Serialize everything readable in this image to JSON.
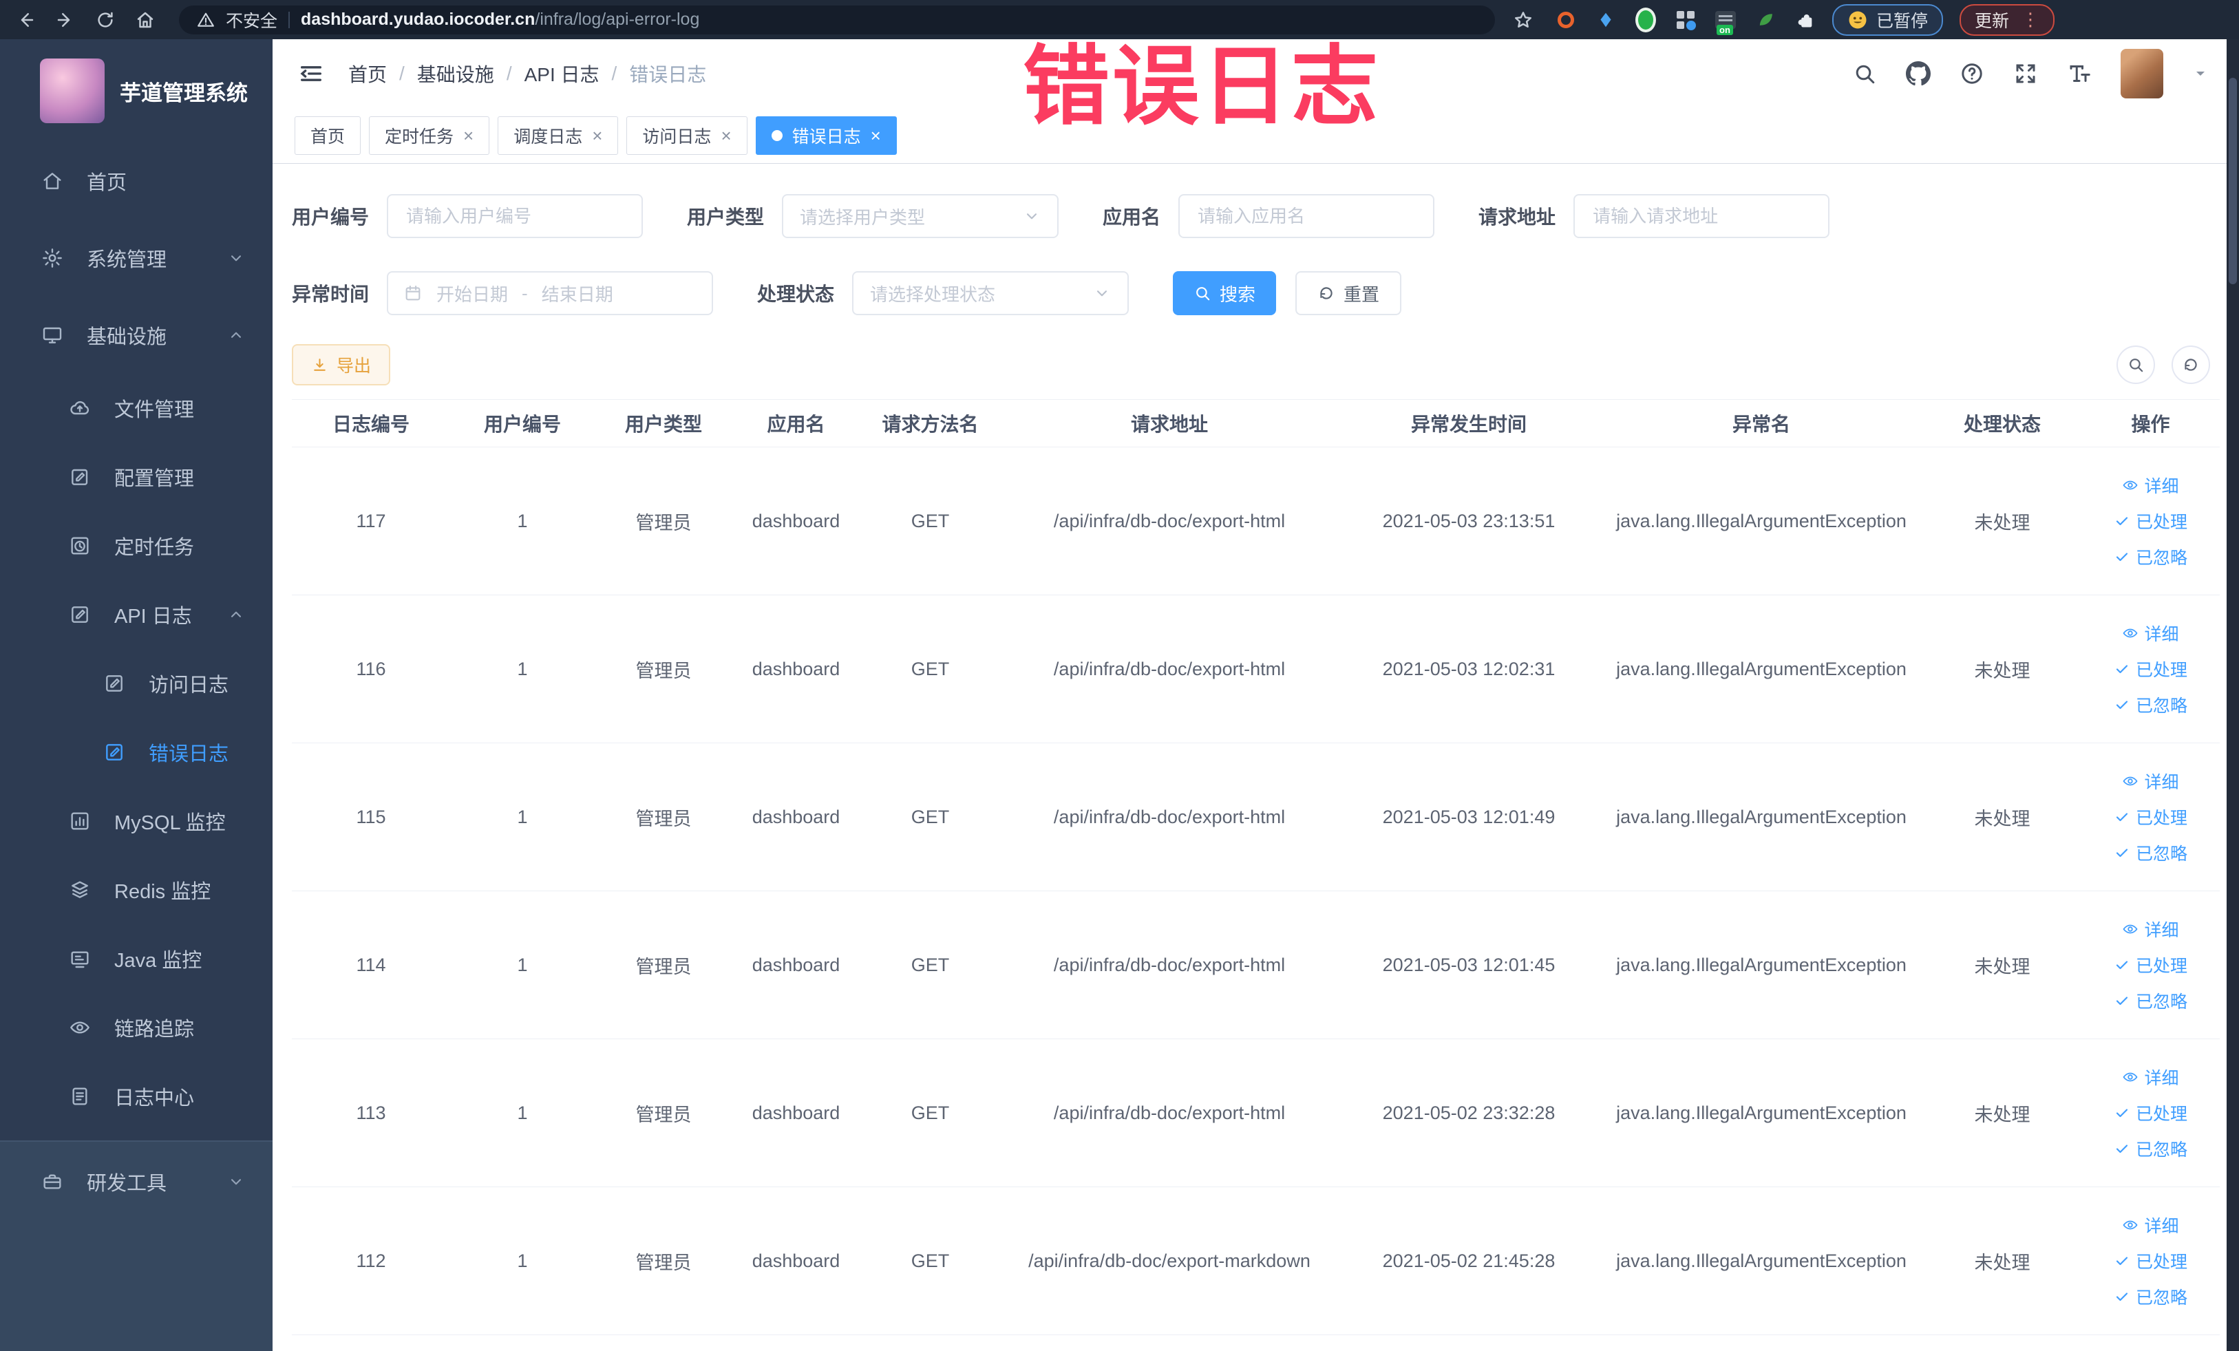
{
  "glyphs": {
    "close": "×",
    "breadcrumb_sep": "/",
    "kebab": "⋮",
    "range_sep": "-"
  },
  "colors": {
    "accent_blue": "#409eff",
    "watermark_red": "#fb3c60",
    "export_orange": "#e6a23c",
    "sidebar_bg": "#2d3b52"
  },
  "browser": {
    "security": "不安全",
    "domain": "dashboard.yudao.iocoder.cn",
    "path": "/infra/log/api-error-log",
    "ext_on_badge": "on",
    "paused": "已暂停",
    "update": "更新"
  },
  "watermark": {
    "text": "错误日志"
  },
  "sidebar": {
    "title": "芋道管理系统",
    "items": [
      {
        "label": "首页"
      },
      {
        "label": "系统管理"
      },
      {
        "label": "基础设施"
      },
      {
        "label": "文件管理"
      },
      {
        "label": "配置管理"
      },
      {
        "label": "定时任务"
      },
      {
        "label": "API 日志"
      },
      {
        "label": "访问日志"
      },
      {
        "label": "错误日志"
      },
      {
        "label": "MySQL 监控"
      },
      {
        "label": "Redis 监控"
      },
      {
        "label": "Java 监控"
      },
      {
        "label": "链路追踪"
      },
      {
        "label": "日志中心"
      },
      {
        "label": "研发工具"
      }
    ]
  },
  "breadcrumb": [
    "首页",
    "基础设施",
    "API 日志",
    "错误日志"
  ],
  "tabs": [
    {
      "label": "首页"
    },
    {
      "label": "定时任务"
    },
    {
      "label": "调度日志"
    },
    {
      "label": "访问日志"
    },
    {
      "label": "错误日志"
    }
  ],
  "filters": {
    "user_id": {
      "label": "用户编号",
      "placeholder": "请输入用户编号"
    },
    "user_type": {
      "label": "用户类型",
      "placeholder": "请选择用户类型"
    },
    "app_name": {
      "label": "应用名",
      "placeholder": "请输入应用名"
    },
    "request_url": {
      "label": "请求地址",
      "placeholder": "请输入请求地址"
    },
    "exception_time": {
      "label": "异常时间",
      "start_placeholder": "开始日期",
      "end_placeholder": "结束日期"
    },
    "process_status": {
      "label": "处理状态",
      "placeholder": "请选择处理状态"
    },
    "search_label": "搜索",
    "reset_label": "重置"
  },
  "toolbar": {
    "export_label": "导出"
  },
  "table": {
    "columns": [
      "日志编号",
      "用户编号",
      "用户类型",
      "应用名",
      "请求方法名",
      "请求地址",
      "异常发生时间",
      "异常名",
      "处理状态",
      "操作"
    ],
    "actions": {
      "detail": "详细",
      "processed": "已处理",
      "ignored": "已忽略"
    },
    "rows": [
      {
        "id": "117",
        "user_id": "1",
        "user_type": "管理员",
        "app": "dashboard",
        "method": "GET",
        "url": "/api/infra/db-doc/export-html",
        "time": "2021-05-03 23:13:51",
        "exception": "java.lang.IllegalArgumentException",
        "status": "未处理"
      },
      {
        "id": "116",
        "user_id": "1",
        "user_type": "管理员",
        "app": "dashboard",
        "method": "GET",
        "url": "/api/infra/db-doc/export-html",
        "time": "2021-05-03 12:02:31",
        "exception": "java.lang.IllegalArgumentException",
        "status": "未处理"
      },
      {
        "id": "115",
        "user_id": "1",
        "user_type": "管理员",
        "app": "dashboard",
        "method": "GET",
        "url": "/api/infra/db-doc/export-html",
        "time": "2021-05-03 12:01:49",
        "exception": "java.lang.IllegalArgumentException",
        "status": "未处理"
      },
      {
        "id": "114",
        "user_id": "1",
        "user_type": "管理员",
        "app": "dashboard",
        "method": "GET",
        "url": "/api/infra/db-doc/export-html",
        "time": "2021-05-03 12:01:45",
        "exception": "java.lang.IllegalArgumentException",
        "status": "未处理"
      },
      {
        "id": "113",
        "user_id": "1",
        "user_type": "管理员",
        "app": "dashboard",
        "method": "GET",
        "url": "/api/infra/db-doc/export-html",
        "time": "2021-05-02 23:32:28",
        "exception": "java.lang.IllegalArgumentException",
        "status": "未处理"
      },
      {
        "id": "112",
        "user_id": "1",
        "user_type": "管理员",
        "app": "dashboard",
        "method": "GET",
        "url": "/api/infra/db-doc/export-markdown",
        "time": "2021-05-02 21:45:28",
        "exception": "java.lang.IllegalArgumentException",
        "status": "未处理"
      }
    ]
  }
}
